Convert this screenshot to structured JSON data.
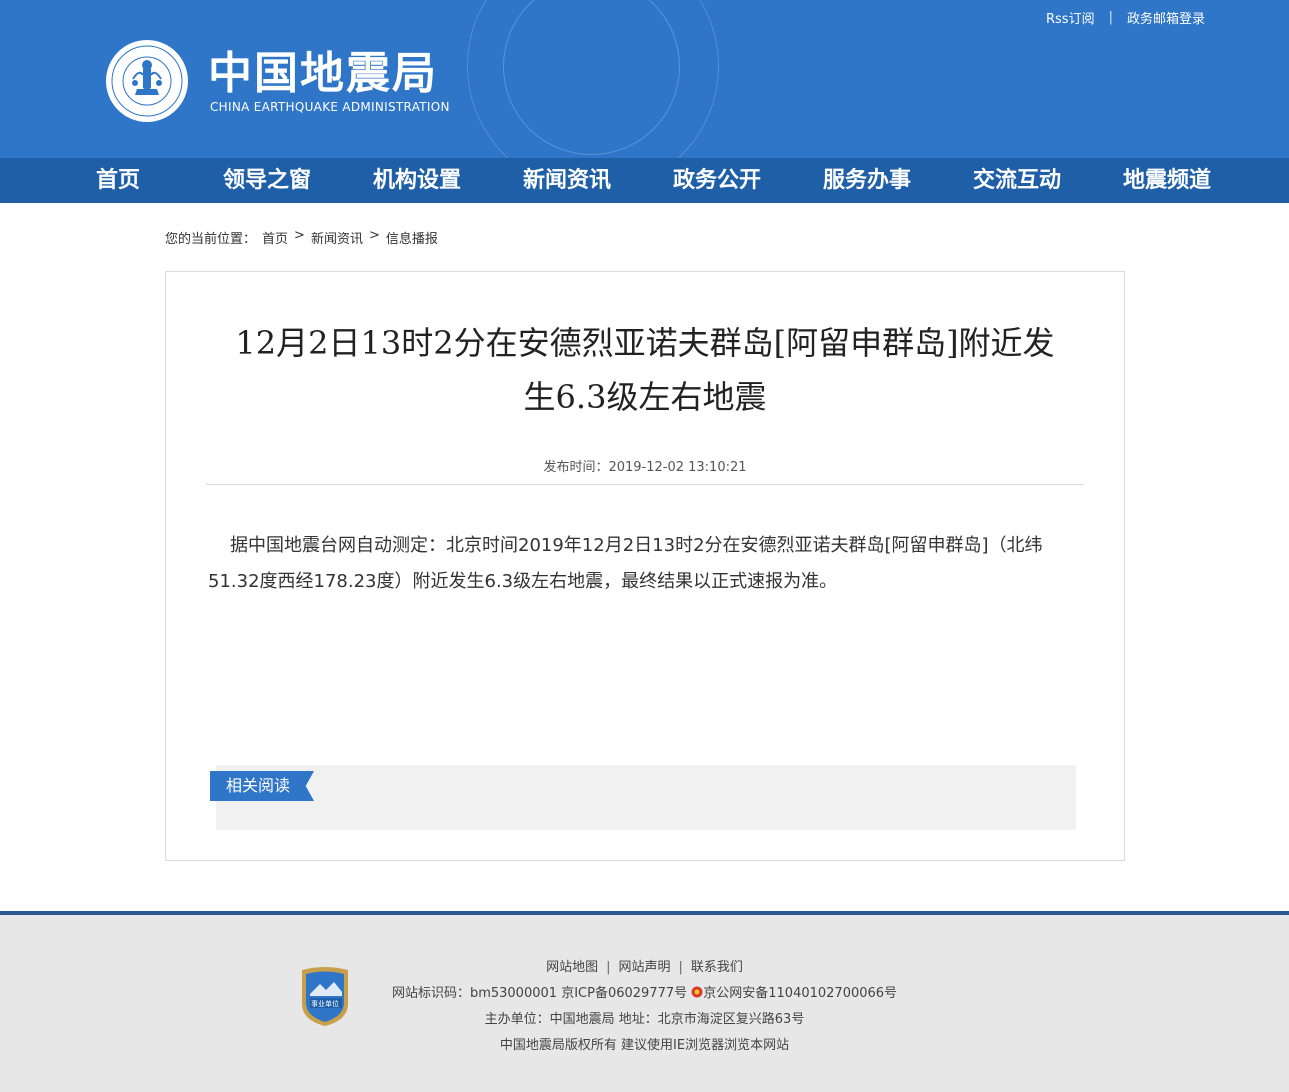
{
  "header": {
    "logo_cn": "中国地震局",
    "logo_en": "CHINA EARTHQUAKE ADMINISTRATION",
    "emblem_text_top": "CHINA EARTHQUAKE ADMINISTRATION",
    "emblem_text_bottom": "中国地震局",
    "top_links": [
      "Rss订阅",
      "政务邮箱登录"
    ],
    "top_sep": "|"
  },
  "nav": {
    "items": [
      "首页",
      "领导之窗",
      "机构设置",
      "新闻资讯",
      "政务公开",
      "服务办事",
      "交流互动",
      "地震频道"
    ]
  },
  "breadcrumb": {
    "label": "您的当前位置：",
    "items": [
      "首页",
      "新闻资讯",
      "信息播报"
    ],
    "sep": ">"
  },
  "article": {
    "title_line1": "12月2日13时2分在安德烈亚诺夫群岛[阿留申群岛]附近发",
    "title_line2": "生6.3级左右地震",
    "meta": "发布时间：2019-12-02 13:10:21",
    "body": "据中国地震台网自动测定：北京时间2019年12月2日13时2分在安德烈亚诺夫群岛[阿留申群岛]（北纬51.32度西经178.23度）附近发生6.3级左右地震，最终结果以正式速报为准。"
  },
  "related": {
    "label": "相关阅读"
  },
  "footer": {
    "links": [
      "网站地图",
      "网站声明",
      "联系我们"
    ],
    "bar": "|",
    "line2_id": "网站标识码：bm53000001",
    "line2_icp": "京ICP备06029777号",
    "line2_police": "京公网安备11040102700066号",
    "line3": "主办单位：中国地震局  地址：北京市海淀区复兴路63号",
    "line4": "中国地震局版权所有  建议使用IE浏览器浏览本网站",
    "badge_text": "事业单位"
  },
  "colors": {
    "header_bg": "#2f76c8",
    "nav_bg": "#1f5fa8",
    "footer_bg": "#e7e7e7",
    "footer_border": "#2a5a93"
  }
}
